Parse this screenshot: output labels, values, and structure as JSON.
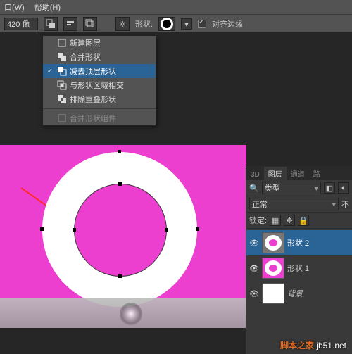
{
  "menubar": {
    "window": "口(W)",
    "help": "帮助(H)"
  },
  "optbar": {
    "width_value": "420 像",
    "shape_label": "形状:",
    "align_label": "对齐边缘"
  },
  "pathops": {
    "items": [
      {
        "label": "新建图层",
        "icon": "new-layer-icon"
      },
      {
        "label": "合并形状",
        "icon": "combine-icon"
      },
      {
        "label": "减去顶层形状",
        "icon": "subtract-icon",
        "selected": true
      },
      {
        "label": "与形状区域相交",
        "icon": "intersect-icon"
      },
      {
        "label": "排除重叠形状",
        "icon": "exclude-icon"
      }
    ],
    "merge_label": "合并形状组件"
  },
  "panels": {
    "tabs": {
      "t3d": "3D",
      "layers": "图层",
      "channels": "通道",
      "paths": "路"
    },
    "filter_label": "类型",
    "blend_label": "正常",
    "opacity_label": "不",
    "lock_label": "锁定:",
    "layers": [
      {
        "name": "形状 2",
        "selected": true
      },
      {
        "name": "形状 1"
      },
      {
        "name": "背景",
        "bg": true
      }
    ]
  },
  "watermark": {
    "site": "jb51.net",
    "brand": "脚本之家"
  }
}
